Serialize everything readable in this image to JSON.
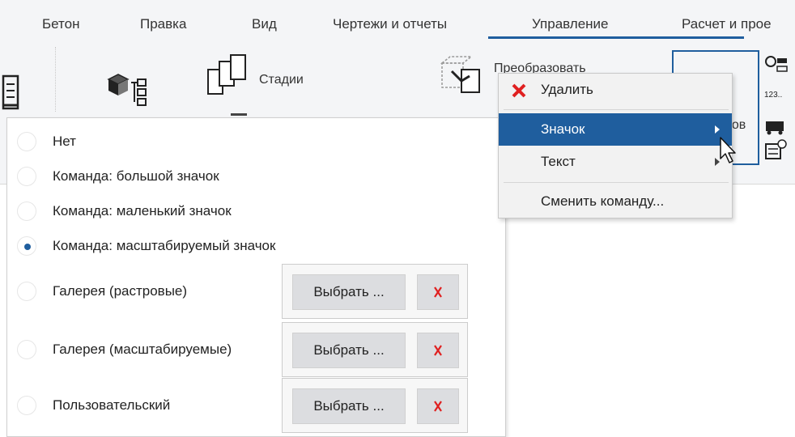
{
  "tabs": [
    {
      "label": "Бетон"
    },
    {
      "label": "Правка"
    },
    {
      "label": "Вид"
    },
    {
      "label": "Чертежи и отчеты"
    },
    {
      "label": "Управление"
    },
    {
      "label": "Расчет и прое"
    }
  ],
  "active_tab_index": 4,
  "ribbon": {
    "stages_label": "Стадии",
    "convert_label": "Преобразовать",
    "partial_label": "ров"
  },
  "context_menu": {
    "delete_label": "Удалить",
    "icon_label": "Значок",
    "text_label": "Текст",
    "change_command_label": "Сменить команду..."
  },
  "icon_options": [
    {
      "label": "Нет",
      "selected": false
    },
    {
      "label": "Команда: большой значок",
      "selected": false
    },
    {
      "label": "Команда: маленький значок",
      "selected": false
    },
    {
      "label": "Команда: масштабируемый значок",
      "selected": true
    },
    {
      "label": "Галерея (растровые)",
      "selected": false
    },
    {
      "label": "Галерея (масштабируемые)",
      "selected": false
    },
    {
      "label": "Пользовательский",
      "selected": false
    }
  ],
  "choose_button_label": "Выбрать ...",
  "colors": {
    "accent": "#1f5e9e",
    "delete_red": "#e02020"
  }
}
